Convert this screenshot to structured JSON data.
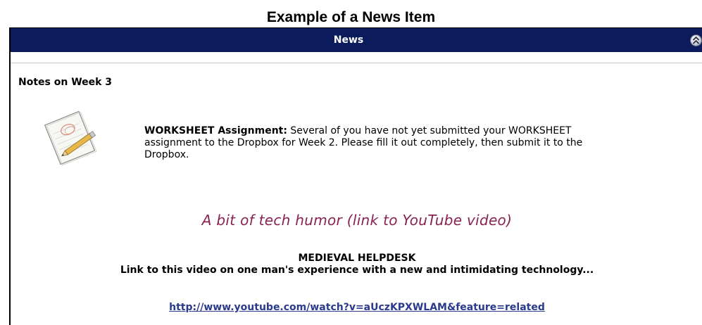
{
  "caption": "Example of a News Item",
  "widget": {
    "title": "News",
    "collapse_icon": "chevron-up-double-icon"
  },
  "news_item": {
    "title": "Notes on Week 3",
    "icon": "notepad-pencil-icon",
    "worksheet_label": "WORKSHEET Assignment:",
    "worksheet_text": " Several of you have not yet submitted your WORKSHEET assignment to the Dropbox for Week 2. Please fill it out completely, then submit it to the Dropbox.",
    "humor_text": "A bit of tech humor (link to YouTube video)",
    "video_heading": "MEDIEVAL HELPDESK",
    "video_description": "Link to this video on one man's experience with a new and intimidating technology...",
    "video_url": "http://www.youtube.com/watch?v=aUczKPXWLAM&feature=related"
  },
  "colors": {
    "header_background": "#0b1b5c",
    "header_text": "#ffffff",
    "humor_text": "#8a2252",
    "link": "#2a3a8c"
  }
}
